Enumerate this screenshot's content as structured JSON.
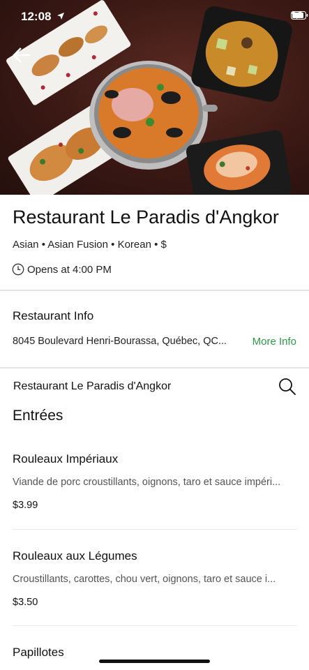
{
  "status_bar": {
    "time": "12:08"
  },
  "restaurant": {
    "name": "Restaurant Le Paradis d'Angkor",
    "tags": "Asian • Asian Fusion • Korean • $",
    "hours": "Opens at 4:00 PM"
  },
  "info": {
    "heading": "Restaurant Info",
    "address": "8045 Boulevard Henri-Bourassa, Québec, QC...",
    "more_info_label": "More Info"
  },
  "menu_bar": {
    "title": "Restaurant Le Paradis d'Angkor"
  },
  "section": {
    "title": "Entrées"
  },
  "items": [
    {
      "name": "Rouleaux Impériaux",
      "description": "Viande de porc croustillants, oignons, taro et sauce impéri...",
      "price": "$3.99"
    },
    {
      "name": "Rouleaux aux Légumes",
      "description": "Croustillants, carottes, chou vert, oignons, taro et sauce i...",
      "price": "$3.50"
    },
    {
      "name": "Papillotes"
    }
  ],
  "colors": {
    "accent_green": "#2b9a45",
    "divider": "#e4e4e4"
  },
  "icons": [
    "back-arrow-icon",
    "clock-icon",
    "search-icon",
    "location-arrow-icon",
    "wifi-icon",
    "battery-icon"
  ]
}
